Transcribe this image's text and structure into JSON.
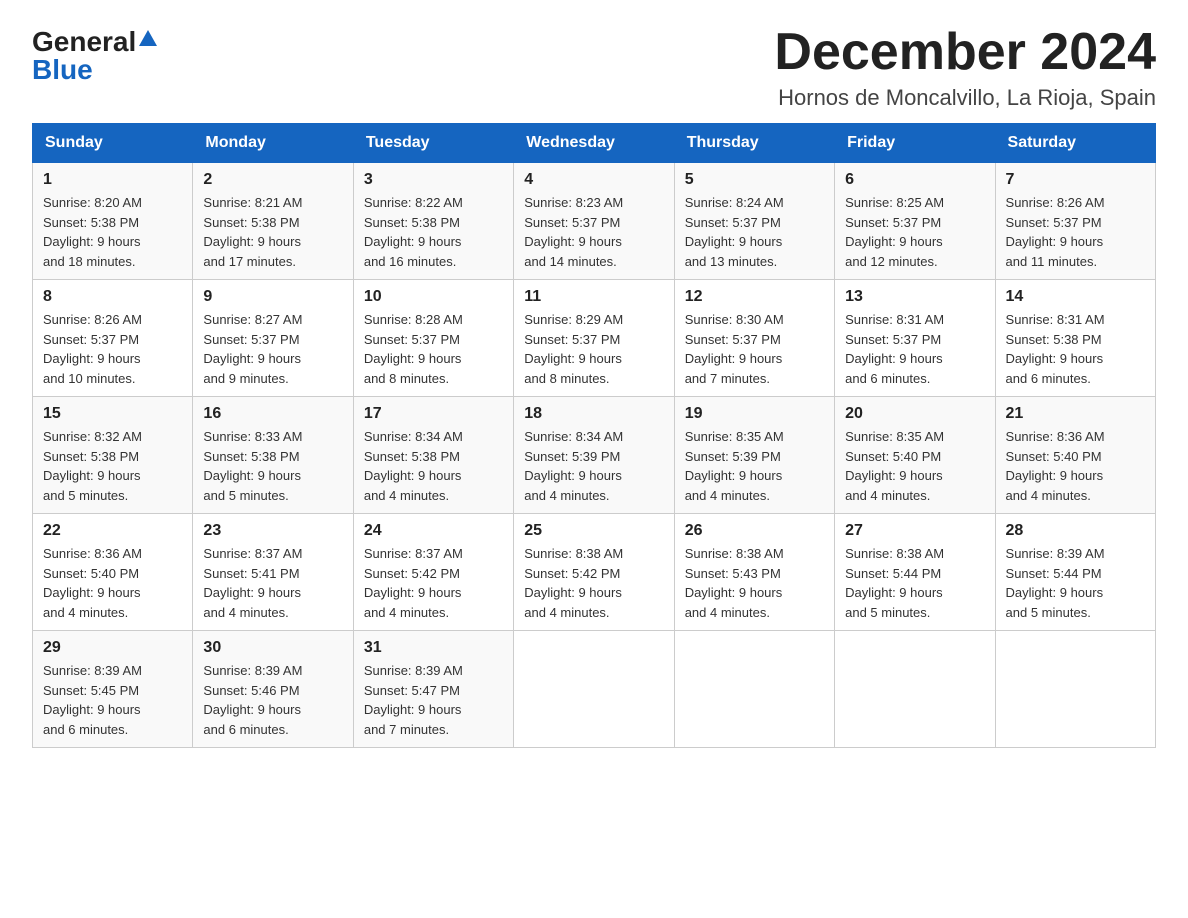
{
  "logo": {
    "general": "General",
    "blue": "Blue",
    "triangle": "▲"
  },
  "title": "December 2024",
  "location": "Hornos de Moncalvillo, La Rioja, Spain",
  "days_header": [
    "Sunday",
    "Monday",
    "Tuesday",
    "Wednesday",
    "Thursday",
    "Friday",
    "Saturday"
  ],
  "weeks": [
    [
      {
        "day": "1",
        "sunrise": "8:20 AM",
        "sunset": "5:38 PM",
        "daylight": "9 hours and 18 minutes."
      },
      {
        "day": "2",
        "sunrise": "8:21 AM",
        "sunset": "5:38 PM",
        "daylight": "9 hours and 17 minutes."
      },
      {
        "day": "3",
        "sunrise": "8:22 AM",
        "sunset": "5:38 PM",
        "daylight": "9 hours and 16 minutes."
      },
      {
        "day": "4",
        "sunrise": "8:23 AM",
        "sunset": "5:37 PM",
        "daylight": "9 hours and 14 minutes."
      },
      {
        "day": "5",
        "sunrise": "8:24 AM",
        "sunset": "5:37 PM",
        "daylight": "9 hours and 13 minutes."
      },
      {
        "day": "6",
        "sunrise": "8:25 AM",
        "sunset": "5:37 PM",
        "daylight": "9 hours and 12 minutes."
      },
      {
        "day": "7",
        "sunrise": "8:26 AM",
        "sunset": "5:37 PM",
        "daylight": "9 hours and 11 minutes."
      }
    ],
    [
      {
        "day": "8",
        "sunrise": "8:26 AM",
        "sunset": "5:37 PM",
        "daylight": "9 hours and 10 minutes."
      },
      {
        "day": "9",
        "sunrise": "8:27 AM",
        "sunset": "5:37 PM",
        "daylight": "9 hours and 9 minutes."
      },
      {
        "day": "10",
        "sunrise": "8:28 AM",
        "sunset": "5:37 PM",
        "daylight": "9 hours and 8 minutes."
      },
      {
        "day": "11",
        "sunrise": "8:29 AM",
        "sunset": "5:37 PM",
        "daylight": "9 hours and 8 minutes."
      },
      {
        "day": "12",
        "sunrise": "8:30 AM",
        "sunset": "5:37 PM",
        "daylight": "9 hours and 7 minutes."
      },
      {
        "day": "13",
        "sunrise": "8:31 AM",
        "sunset": "5:37 PM",
        "daylight": "9 hours and 6 minutes."
      },
      {
        "day": "14",
        "sunrise": "8:31 AM",
        "sunset": "5:38 PM",
        "daylight": "9 hours and 6 minutes."
      }
    ],
    [
      {
        "day": "15",
        "sunrise": "8:32 AM",
        "sunset": "5:38 PM",
        "daylight": "9 hours and 5 minutes."
      },
      {
        "day": "16",
        "sunrise": "8:33 AM",
        "sunset": "5:38 PM",
        "daylight": "9 hours and 5 minutes."
      },
      {
        "day": "17",
        "sunrise": "8:34 AM",
        "sunset": "5:38 PM",
        "daylight": "9 hours and 4 minutes."
      },
      {
        "day": "18",
        "sunrise": "8:34 AM",
        "sunset": "5:39 PM",
        "daylight": "9 hours and 4 minutes."
      },
      {
        "day": "19",
        "sunrise": "8:35 AM",
        "sunset": "5:39 PM",
        "daylight": "9 hours and 4 minutes."
      },
      {
        "day": "20",
        "sunrise": "8:35 AM",
        "sunset": "5:40 PM",
        "daylight": "9 hours and 4 minutes."
      },
      {
        "day": "21",
        "sunrise": "8:36 AM",
        "sunset": "5:40 PM",
        "daylight": "9 hours and 4 minutes."
      }
    ],
    [
      {
        "day": "22",
        "sunrise": "8:36 AM",
        "sunset": "5:40 PM",
        "daylight": "9 hours and 4 minutes."
      },
      {
        "day": "23",
        "sunrise": "8:37 AM",
        "sunset": "5:41 PM",
        "daylight": "9 hours and 4 minutes."
      },
      {
        "day": "24",
        "sunrise": "8:37 AM",
        "sunset": "5:42 PM",
        "daylight": "9 hours and 4 minutes."
      },
      {
        "day": "25",
        "sunrise": "8:38 AM",
        "sunset": "5:42 PM",
        "daylight": "9 hours and 4 minutes."
      },
      {
        "day": "26",
        "sunrise": "8:38 AM",
        "sunset": "5:43 PM",
        "daylight": "9 hours and 4 minutes."
      },
      {
        "day": "27",
        "sunrise": "8:38 AM",
        "sunset": "5:44 PM",
        "daylight": "9 hours and 5 minutes."
      },
      {
        "day": "28",
        "sunrise": "8:39 AM",
        "sunset": "5:44 PM",
        "daylight": "9 hours and 5 minutes."
      }
    ],
    [
      {
        "day": "29",
        "sunrise": "8:39 AM",
        "sunset": "5:45 PM",
        "daylight": "9 hours and 6 minutes."
      },
      {
        "day": "30",
        "sunrise": "8:39 AM",
        "sunset": "5:46 PM",
        "daylight": "9 hours and 6 minutes."
      },
      {
        "day": "31",
        "sunrise": "8:39 AM",
        "sunset": "5:47 PM",
        "daylight": "9 hours and 7 minutes."
      },
      null,
      null,
      null,
      null
    ]
  ],
  "labels": {
    "sunrise": "Sunrise:",
    "sunset": "Sunset:",
    "daylight": "Daylight:"
  }
}
